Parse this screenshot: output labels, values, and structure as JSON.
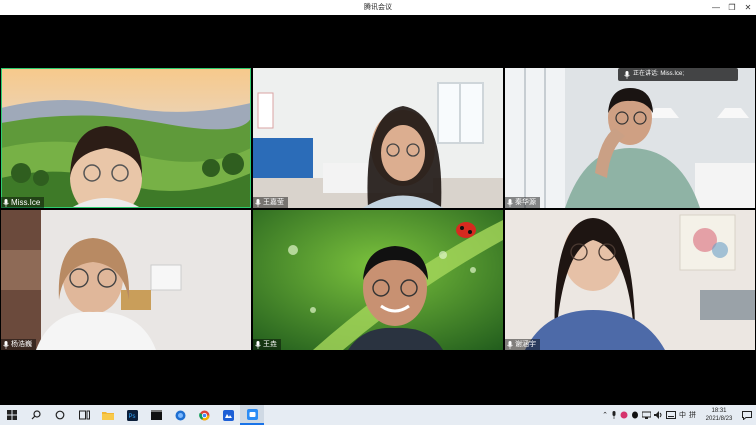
{
  "window": {
    "title": "腾讯会议",
    "min_glyph": "—",
    "max_glyph": "❐",
    "close_glyph": "✕"
  },
  "talking": {
    "label": "正在讲话: Miss.Ice;"
  },
  "participants": [
    {
      "name": "Miss.Ice"
    },
    {
      "name": "王嘉莹"
    },
    {
      "name": "秦华源"
    },
    {
      "name": "杨浩巍"
    },
    {
      "name": "王垚"
    },
    {
      "name": "谢涵宇"
    }
  ],
  "tray": {
    "ime": "中",
    "ime2": "拼",
    "time": "18:31",
    "date": "2021/8/23"
  },
  "colors": {
    "active_border": "#2ecc71",
    "taskbar": "#e6ecf3"
  },
  "icons": [
    "windows-start-icon",
    "search-icon",
    "cortana-icon",
    "task-view-icon",
    "file-explorer-icon",
    "photoshop-icon",
    "terminal-icon",
    "browser-icon",
    "chrome-icon",
    "app-icon",
    "tencent-meeting-icon"
  ]
}
